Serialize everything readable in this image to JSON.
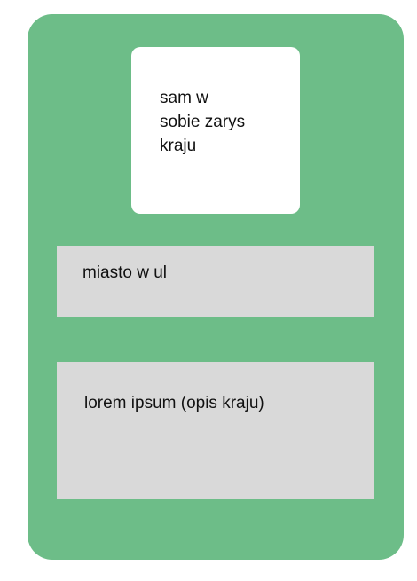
{
  "theme": {
    "card_color": "#6dbd88",
    "box_color": "#ffffff",
    "panel_color": "#d9d9d9",
    "text_color": "#111111"
  },
  "card": {
    "outline_text": "sam w\nsobie zarys\nkraju",
    "city_text": "miasto w ul",
    "description_text": "lorem ipsum (opis kraju)"
  }
}
